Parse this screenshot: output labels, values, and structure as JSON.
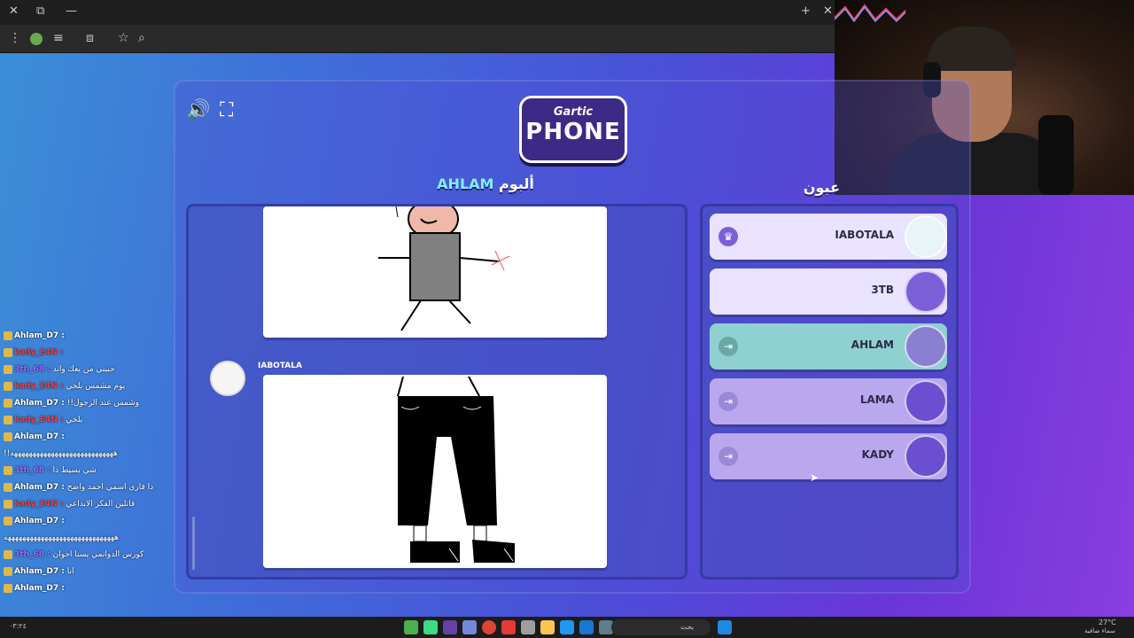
{
  "browser": {
    "close_icon": "✕",
    "tab_icon": "⧉",
    "minimize_icon": "—",
    "new_tab_icon": "+",
    "menu_icon": "⋮",
    "star_icon": "☆",
    "search_icon": "⌕"
  },
  "chat": {
    "lines": [
      {
        "user": "Ahlam_D7 :",
        "text": ""
      },
      {
        "user": "kady_E4N :",
        "text": ""
      },
      {
        "user": "3th_68 :",
        "text": "حبيبي من يعك واند"
      },
      {
        "user": "kady_E4N :",
        "text": "يوم مشمس بلخي"
      },
      {
        "user": "Ahlam_D7 :",
        "text": "!!وشمس عند الرجول"
      },
      {
        "user": "kady_E4N :",
        "text": "بلخي"
      },
      {
        "user": "Ahlam_D7 :",
        "text": ""
      },
      {
        "user": "",
        "text": "!!ههههههههههههههههههههههههههههه"
      },
      {
        "user": "3th_68 :",
        "text": "شي بسيط ذا"
      },
      {
        "user": "Ahlam_D7 :",
        "text": "ذا قاري اسمي احمد واضح"
      },
      {
        "user": "kady_E4N :",
        "text": "قاتلين الفكر الابداعي"
      },
      {
        "user": "Ahlam_D7 :",
        "text": ""
      },
      {
        "user": "",
        "text": "ههههههههههههههههههههههههههههههه"
      },
      {
        "user": "3th_68 :",
        "text": "كورس الدوانمي يسنا احوان"
      },
      {
        "user": "Ahlam_D7 :",
        "text": "انا"
      },
      {
        "user": "Ahlam_D7 :",
        "text": ""
      }
    ]
  },
  "game": {
    "logo_top": "Gartic",
    "logo_bottom": "PHONE",
    "album_prefix": "ألبوم",
    "album_owner": "AHLAM",
    "players_title": "عبون",
    "volume_icon": "🔊",
    "fullscreen_icon": "⛶",
    "author": "IABOTALA",
    "players": [
      {
        "name": "IABOTALA",
        "icon": "♛",
        "bg": "#e9e3ff",
        "avatar_color": "#e8f4f8",
        "icon_bg": "#7b5fd9"
      },
      {
        "name": "3TB",
        "icon": "",
        "bg": "#e9e3ff",
        "avatar_color": "#7a5fd9",
        "icon_bg": "transparent"
      },
      {
        "name": "AHLAM",
        "icon": "⇥",
        "bg": "#8fd0d0",
        "avatar_color": "#8a7fd0",
        "icon_bg": "#6aa8a8"
      },
      {
        "name": "LAMA",
        "icon": "⇥",
        "bg": "#b9a8ee",
        "avatar_color": "#6a4fd0",
        "icon_bg": "#9a88d8"
      },
      {
        "name": "KADY",
        "icon": "⇥",
        "bg": "#b9a8ee",
        "avatar_color": "#6a4fd0",
        "icon_bg": "#9a88d8"
      }
    ]
  },
  "taskbar": {
    "search_placeholder": "بحث",
    "weather": "27°C",
    "weather_desc": "سماء صافية"
  }
}
